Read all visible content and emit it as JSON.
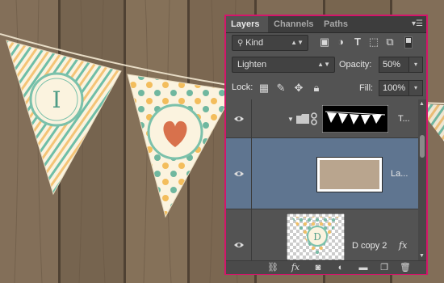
{
  "panel": {
    "tabs": [
      {
        "label": "Layers",
        "active": true
      },
      {
        "label": "Channels",
        "active": false
      },
      {
        "label": "Paths",
        "active": false
      }
    ],
    "filter": {
      "value": "Kind"
    },
    "blend_mode": {
      "value": "Lighten"
    },
    "opacity": {
      "label": "Opacity:",
      "value": "50%"
    },
    "lock": {
      "label": "Lock:"
    },
    "fill": {
      "label": "Fill:",
      "value": "100%"
    },
    "layers": [
      {
        "name": "T...",
        "type": "group",
        "visible": true,
        "selected": false
      },
      {
        "name": "La...",
        "type": "layer",
        "visible": true,
        "selected": true
      },
      {
        "name": "D copy 2",
        "type": "layer",
        "visible": true,
        "selected": false,
        "has_fx": true
      }
    ],
    "fx_label": "fx",
    "bottom_fx": "fx"
  },
  "banner": {
    "flag1_letter": "I",
    "flag3_letter": "D"
  },
  "colors": {
    "panel_border": "#d4156a",
    "panel_bg": "#535353",
    "selected_layer": "#5f7590",
    "wood": "#7d6b57",
    "teal": "#5bab96",
    "orange": "#f2b35a",
    "heart": "#d8714c"
  }
}
